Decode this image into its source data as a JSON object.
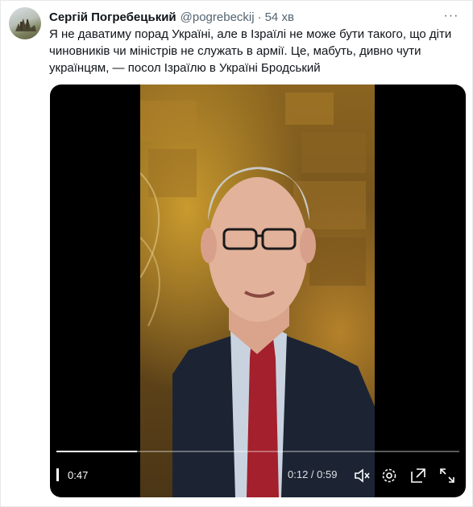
{
  "tweet": {
    "author_name": "Сергій Погребецький",
    "handle": "@pogrebeckij",
    "separator": "·",
    "time": "54 хв",
    "text": "Я не даватиму порад Україні, але в Ізраїлі не може бути такого, що діти чиновників чи міністрів не служать в армії. Це, мабуть, дивно чути українцям, — посол Ізраїлю в Україні Бродський",
    "more_label": "···"
  },
  "video": {
    "elapsed": "0:47",
    "time_display": "0:12 / 0:59",
    "progress": 0.2,
    "icons": [
      "pause-icon",
      "mute-icon",
      "settings-icon",
      "popout-icon",
      "fullscreen-icon"
    ]
  }
}
